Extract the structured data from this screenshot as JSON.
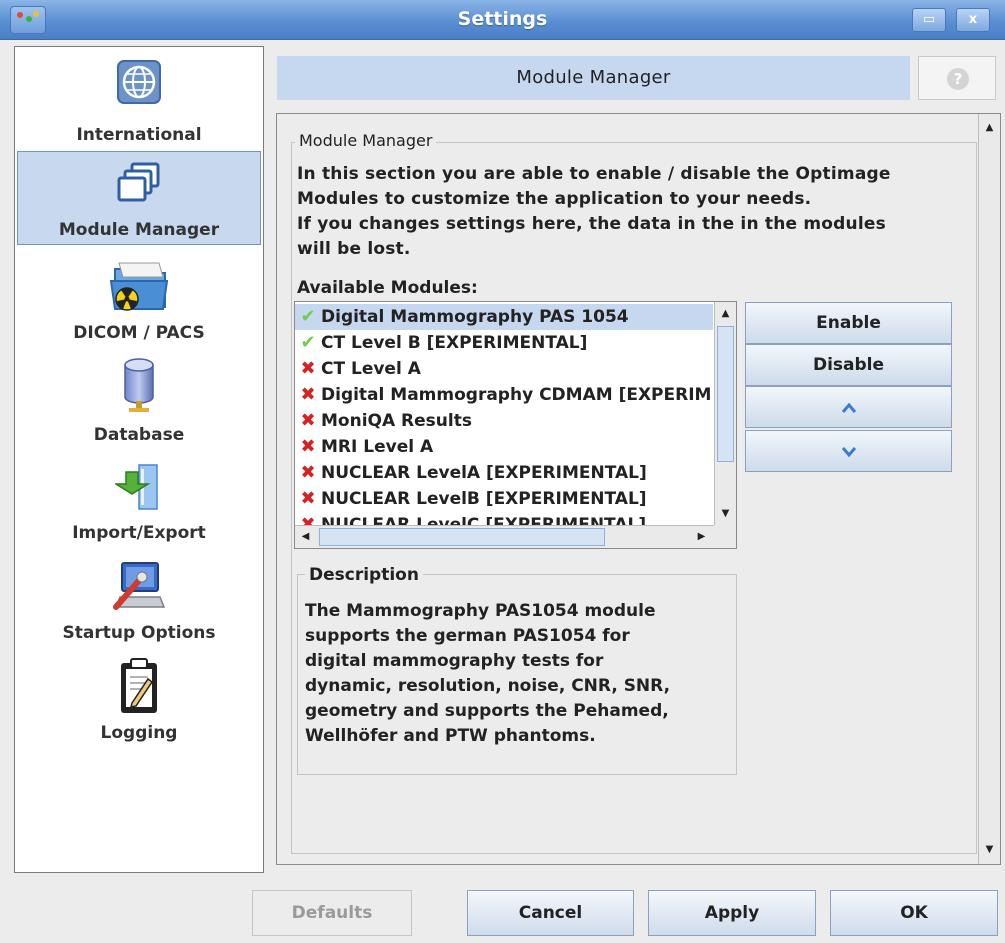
{
  "window": {
    "title": "Settings",
    "minimize_label": "▭",
    "close_label": "x"
  },
  "sidebar": {
    "items": [
      {
        "label": "International",
        "icon": "globe-icon"
      },
      {
        "label": "Module Manager",
        "icon": "windows-icon",
        "selected": true
      },
      {
        "label": "DICOM / PACS",
        "icon": "radiation-folder-icon"
      },
      {
        "label": "Database",
        "icon": "database-icon"
      },
      {
        "label": "Import/Export",
        "icon": "import-export-icon"
      },
      {
        "label": "Startup Options",
        "icon": "startup-computer-icon"
      },
      {
        "label": "Logging",
        "icon": "clipboard-icon"
      }
    ]
  },
  "header": {
    "title": "Module Manager",
    "help_label": "?"
  },
  "module_manager": {
    "legend": "Module Manager",
    "intro_lines": [
      "In this section you are able to enable / disable the Optimage",
      "Modules to customize the application to your needs.",
      "If you changes settings here, the data in the in the modules",
      "will be lost."
    ],
    "available_label": "Available Modules:",
    "modules": [
      {
        "name": "Digital Mammography PAS 1054",
        "enabled": true,
        "selected": true
      },
      {
        "name": "CT Level B [EXPERIMENTAL]",
        "enabled": true
      },
      {
        "name": "CT Level A",
        "enabled": false
      },
      {
        "name": "Digital Mammography CDMAM [EXPERIMENTAL]",
        "enabled": false
      },
      {
        "name": "MoniQA Results",
        "enabled": false
      },
      {
        "name": "MRI Level A",
        "enabled": false
      },
      {
        "name": "NUCLEAR LevelA [EXPERIMENTAL]",
        "enabled": false
      },
      {
        "name": "NUCLEAR LevelB [EXPERIMENTAL]",
        "enabled": false
      },
      {
        "name": "NUCLEAR LevelC [EXPERIMENTAL]",
        "enabled": false
      }
    ],
    "buttons": {
      "enable": "Enable",
      "disable": "Disable",
      "move_up": "⌃",
      "move_down": "⌄"
    },
    "description": {
      "legend": "Description",
      "lines": [
        "The Mammography PAS1054 module",
        "supports the german PAS1054 for",
        "digital mammography tests for",
        "dynamic, resolution, noise, CNR, SNR,",
        "geometry and supports the Pehamed,",
        "Wellhöfer and PTW phantoms."
      ]
    }
  },
  "footer": {
    "defaults": "Defaults",
    "cancel": "Cancel",
    "apply": "Apply",
    "ok": "OK"
  },
  "colors": {
    "titlebar": "#5a8fd4",
    "selection": "#c6d8ef",
    "enabled_check": "#6fcf4a",
    "disabled_x": "#d92020"
  }
}
